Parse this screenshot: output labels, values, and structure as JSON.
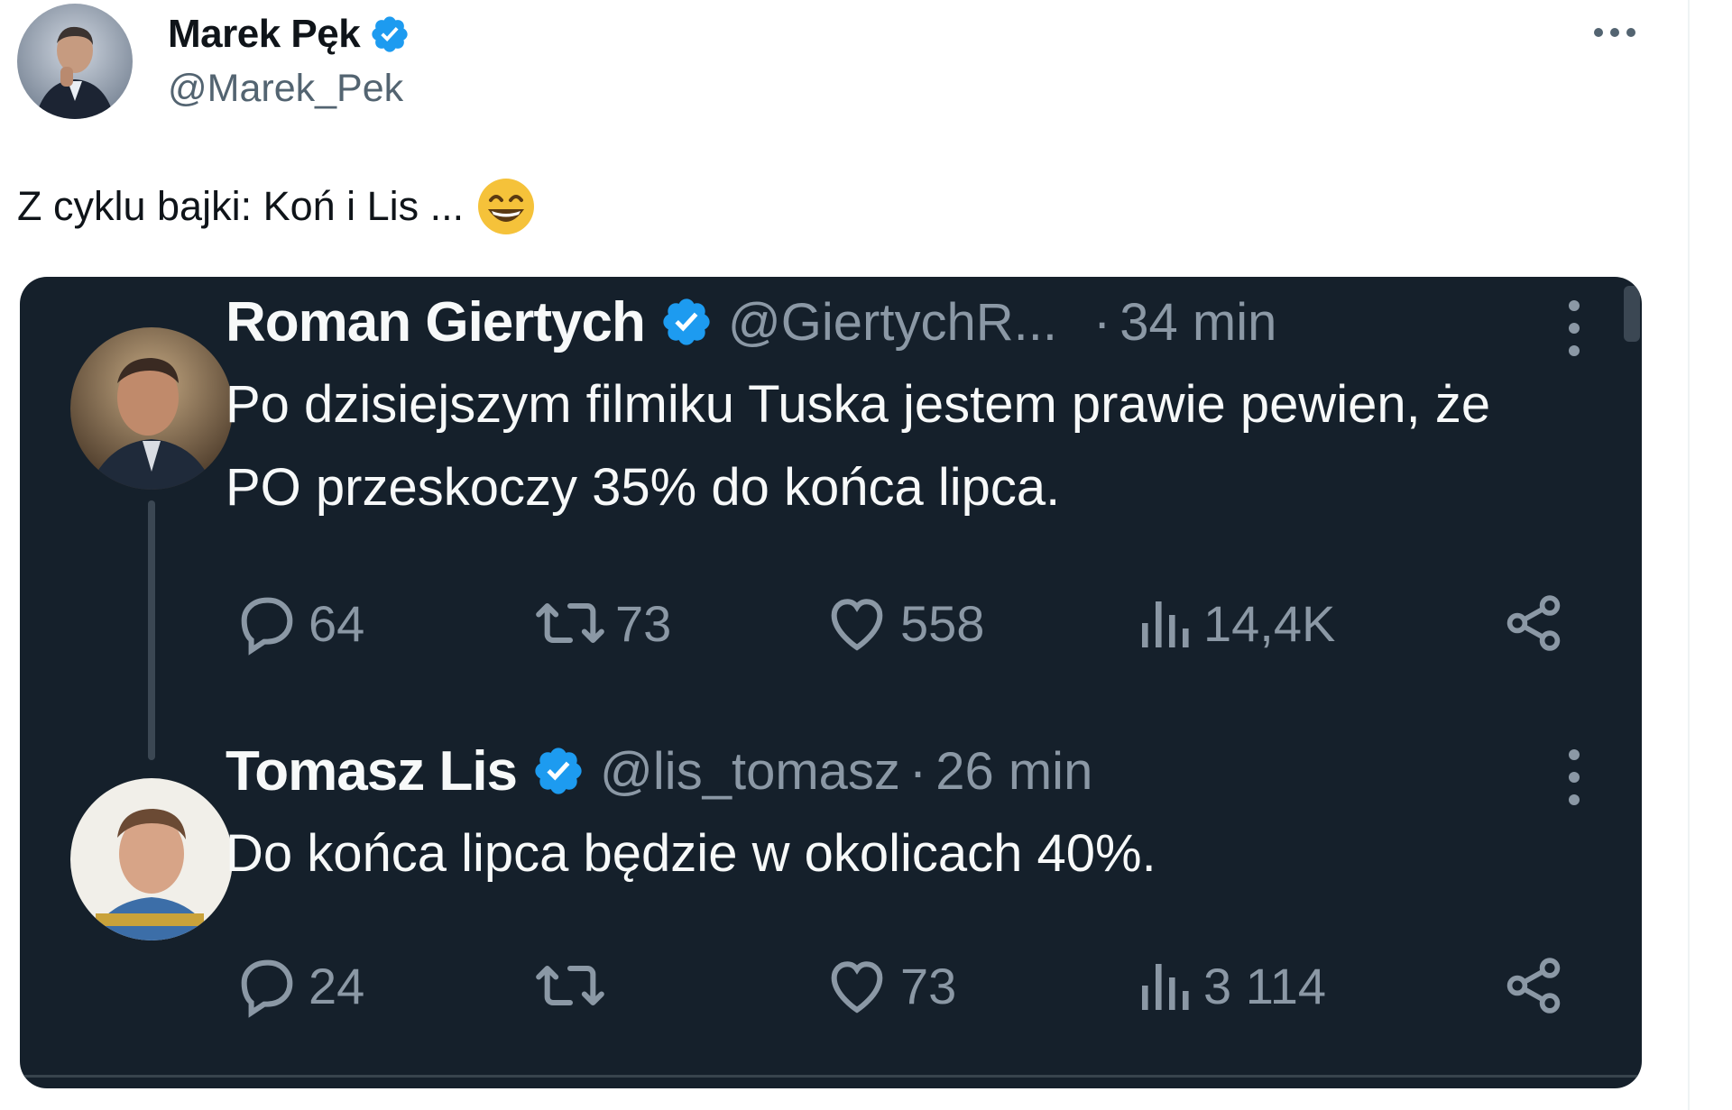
{
  "tweet": {
    "author": {
      "name": "Marek Pęk",
      "handle": "@Marek_Pek"
    },
    "text": "Z cyklu bajki: Koń i Lis ...",
    "emoji": "grinning-squinting-face"
  },
  "embedded_screenshot": {
    "posts": [
      {
        "name": "Roman Giertych",
        "handle": "@GiertychR...",
        "separator": "·",
        "time": "34 min",
        "text": "Po dzisiejszym filmiku Tuska jestem prawie pewien, że PO przeskoczy 35% do końca lipca.",
        "actions": {
          "replies": "64",
          "reposts": "73",
          "likes": "558",
          "views": "14,4K"
        }
      },
      {
        "name": "Tomasz Lis",
        "handle": "@lis_tomasz",
        "separator": "·",
        "time": "26 min",
        "text": "Do końca lipca będzie w okolicach 40%.",
        "actions": {
          "replies": "24",
          "reposts": "",
          "likes": "73",
          "views": "3 114"
        }
      }
    ]
  },
  "colors": {
    "verified": "#1d9bf0",
    "embed_background": "#15202b",
    "secondary_text": "#536471",
    "embed_secondary_text": "#8b98a5"
  }
}
